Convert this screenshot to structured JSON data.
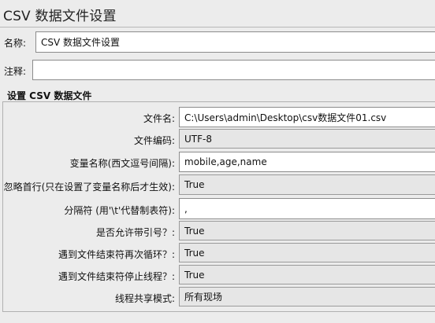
{
  "panel": {
    "title": "CSV 数据文件设置"
  },
  "name_field": {
    "label": "名称:",
    "value": "CSV 数据文件设置"
  },
  "comment_field": {
    "label": "注释:",
    "value": ""
  },
  "group": {
    "title": "设置 CSV 数据文件",
    "rows": [
      {
        "label": "文件名:",
        "value": "C:\\Users\\admin\\Desktop\\csv数据文件01.csv",
        "type": "text"
      },
      {
        "label": "文件编码:",
        "value": "UTF-8",
        "type": "combo"
      },
      {
        "label": "变量名称(西文逗号间隔):",
        "value": "mobile,age,name",
        "type": "text"
      },
      {
        "label": "忽略首行(只在设置了变量名称后才生效):",
        "value": "True",
        "type": "combo"
      },
      {
        "label": "分隔符 (用'\\t'代替制表符):",
        "value": ",",
        "type": "text"
      },
      {
        "label": "是否允许带引号？:",
        "value": "True",
        "type": "combo"
      },
      {
        "label": "遇到文件结束符再次循环？:",
        "value": "True",
        "type": "combo"
      },
      {
        "label": "遇到文件结束符停止线程？:",
        "value": "True",
        "type": "combo"
      },
      {
        "label": "线程共享模式:",
        "value": "所有现场",
        "type": "combo"
      }
    ]
  }
}
